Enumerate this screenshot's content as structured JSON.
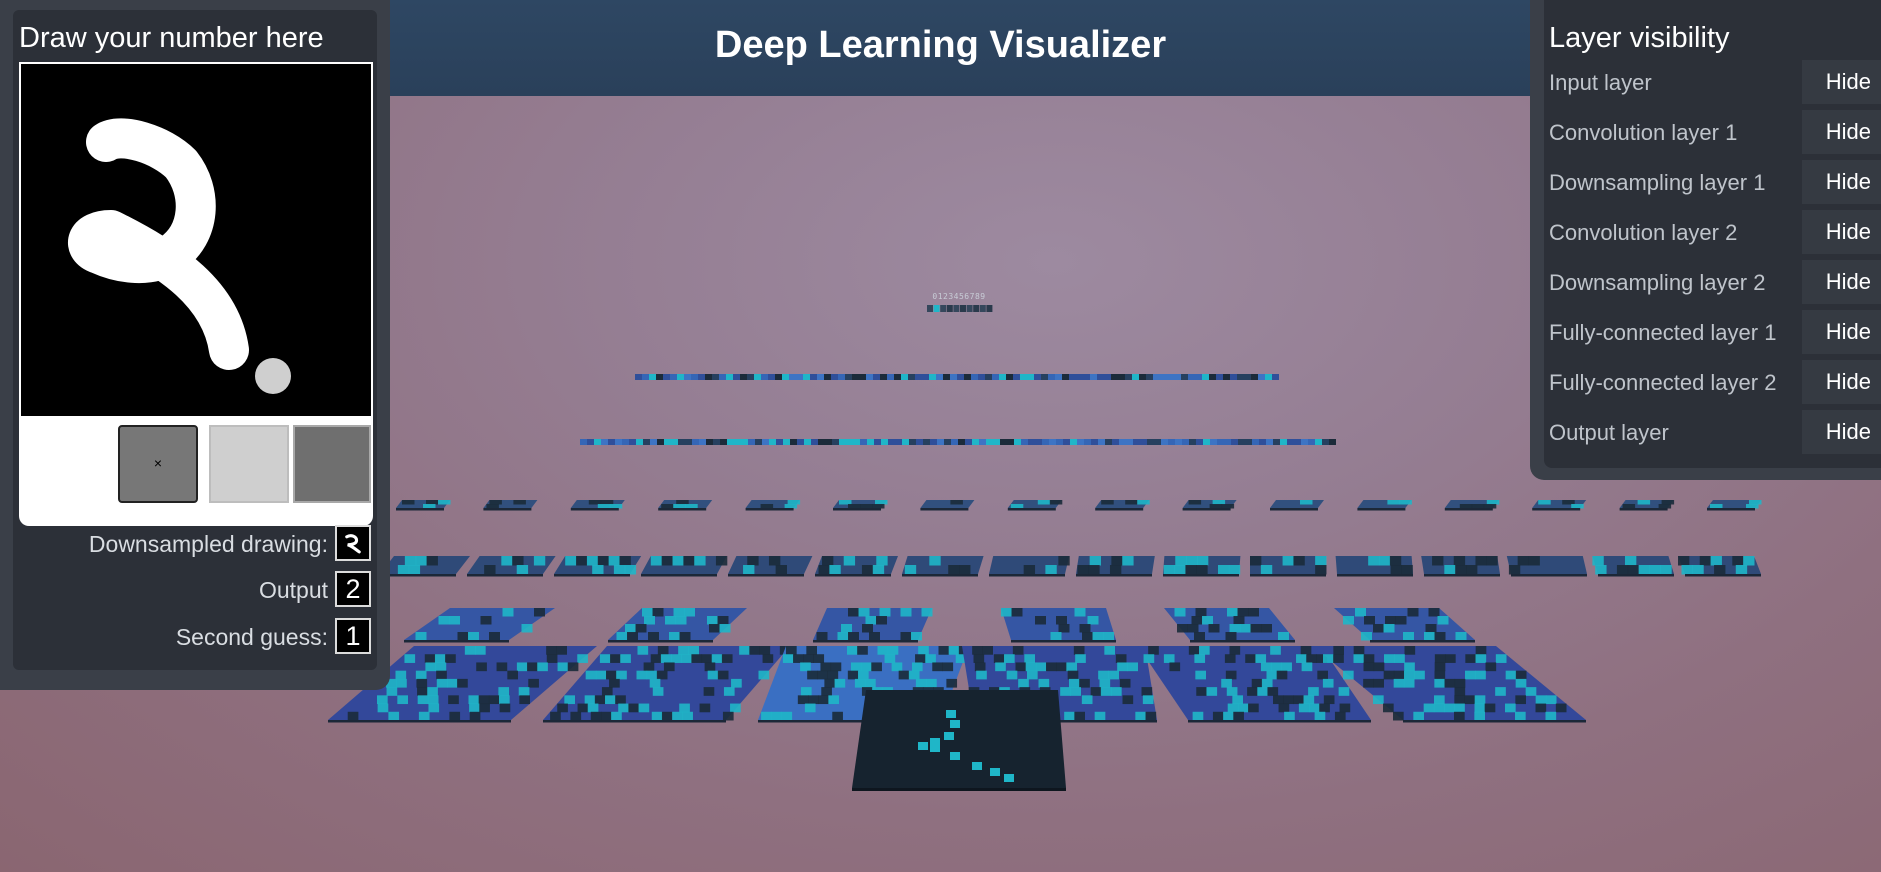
{
  "header": {
    "title": "Deep Learning Visualizer"
  },
  "draw_panel": {
    "title": "Draw your number here",
    "tools": {
      "clear_icon": "×",
      "clear_icon_name": "close-icon"
    },
    "downsampled_label": "Downsampled drawing:",
    "output_label": "Output",
    "output_value": "2",
    "second_guess_label": "Second guess:",
    "second_guess_value": "1"
  },
  "layers_panel": {
    "title": "Layer visibility",
    "layers": [
      {
        "label": "Input layer",
        "button": "Hide"
      },
      {
        "label": "Convolution layer 1",
        "button": "Hide"
      },
      {
        "label": "Downsampling layer 1",
        "button": "Hide"
      },
      {
        "label": "Convolution layer 2",
        "button": "Hide"
      },
      {
        "label": "Downsampling layer 2",
        "button": "Hide"
      },
      {
        "label": "Fully-connected layer 1",
        "button": "Hide"
      },
      {
        "label": "Fully-connected layer 2",
        "button": "Hide"
      },
      {
        "label": "Output layer",
        "button": "Hide"
      }
    ]
  },
  "scene": {
    "output_digits": "0123456789",
    "colors": {
      "cyan": "#1fb6c8",
      "dark": "#1b2b3a",
      "blue": "#2f4f9a",
      "mid_blue": "#3566b6"
    }
  }
}
